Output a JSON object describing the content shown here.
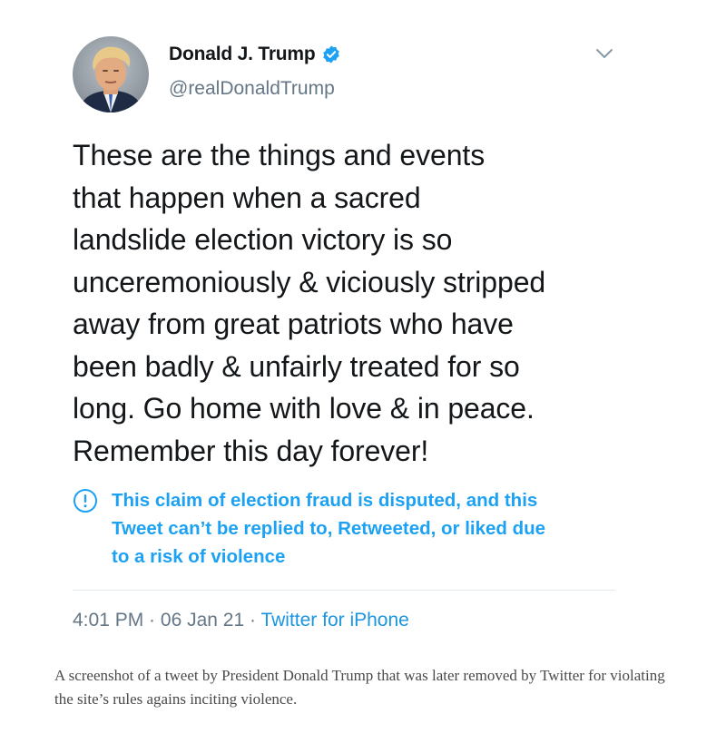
{
  "tweet": {
    "display_name": "Donald J. Trump",
    "handle": "@realDonaldTrump",
    "avatar_icon": "profile-photo-icon",
    "verified_icon": "verified-badge-icon",
    "menu_icon": "chevron-down-icon",
    "text": "These are the things and events\nthat happen when a sacred\nlandslide election victory is so\nunceremoniously & viciously stripped\naway from great patriots who have\nbeen badly & unfairly treated for so\nlong. Go home with love & in peace.\nRemember this day forever!",
    "notice": {
      "icon": "exclamation-circle-icon",
      "text": "This claim of election fraud is disputed, and this\nTweet can’t be replied to, Retweeted, or liked due\nto a risk of violence"
    },
    "time": "4:01 PM",
    "sep1": " · ",
    "date": "06 Jan 21",
    "sep2": " · ",
    "source": "Twitter for iPhone"
  },
  "caption": "A screenshot of a tweet by President Donald Trump that was later removed by Twitter for violating the site’s rules agains inciting violence.",
  "colors": {
    "text": "#14171a",
    "secondary": "#657786",
    "accent": "#1da1f2",
    "link": "#1b95e0",
    "divider": "#e1e8ed"
  }
}
